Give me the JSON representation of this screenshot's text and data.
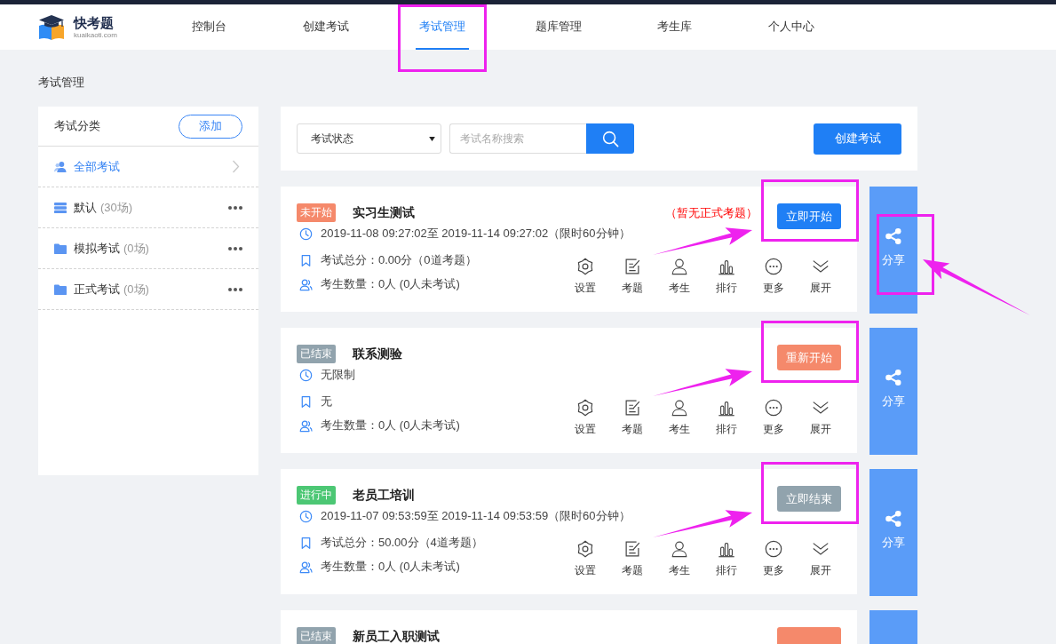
{
  "header": {
    "logo": {
      "name": "快考题",
      "domain": "kuaikaoti.com"
    },
    "tabs": [
      {
        "label": "控制台",
        "selected": false,
        "highlighted": false
      },
      {
        "label": "创建考试",
        "selected": false,
        "highlighted": false
      },
      {
        "label": "考试管理",
        "selected": true,
        "highlighted": true
      },
      {
        "label": "题库管理",
        "selected": false,
        "highlighted": false
      },
      {
        "label": "考生库",
        "selected": false,
        "highlighted": false
      },
      {
        "label": "个人中心",
        "selected": false,
        "highlighted": false
      }
    ]
  },
  "page_title": "考试管理",
  "categories": {
    "title": "考试分类",
    "add_button": "添加",
    "items": [
      {
        "label": "全部考试",
        "kind": "all",
        "selected": true
      },
      {
        "label": "默认",
        "count": "(30场)",
        "kind": "default",
        "selected": false
      },
      {
        "label": "模拟考试",
        "count": "(0场)",
        "kind": "folder",
        "selected": false
      },
      {
        "label": "正式考试",
        "count": "(0场)",
        "kind": "folder",
        "selected": false
      }
    ]
  },
  "toolbar": {
    "status_filter": {
      "value": "考试状态"
    },
    "search": {
      "placeholder": "考试名称搜索"
    },
    "create_button": "创建考试"
  },
  "exams": [
    {
      "status": {
        "label": "未开始",
        "kind": "not_started"
      },
      "title": "实习生测试",
      "note": "（暂无正式考题）",
      "details": [
        {
          "kind": "time",
          "text": "2019-11-08 09:27:02至 2019-11-14 09:27:02（限时60分钟）"
        },
        {
          "kind": "score",
          "text": "考试总分：0.00分（0道考题）"
        },
        {
          "kind": "examinees",
          "text": "考生数量：0人 (0人未考试)"
        }
      ],
      "action": {
        "label": "立即开始",
        "kind": "start",
        "highlighted": true,
        "pointed_at": true
      },
      "tools": [
        {
          "kind": "settings",
          "label": "设置"
        },
        {
          "kind": "questions",
          "label": "考题"
        },
        {
          "kind": "examinees",
          "label": "考生"
        },
        {
          "kind": "ranking",
          "label": "排行"
        },
        {
          "kind": "more",
          "label": "更多"
        },
        {
          "kind": "expand",
          "label": "展开"
        }
      ],
      "share": {
        "label": "分享",
        "highlighted": true,
        "pointed_at": true
      }
    },
    {
      "status": {
        "label": "已结束",
        "kind": "ended"
      },
      "title": "联系测验",
      "details": [
        {
          "kind": "time",
          "text": "无限制"
        },
        {
          "kind": "score",
          "text": "无"
        },
        {
          "kind": "examinees",
          "text": "考生数量：0人 (0人未考试)"
        }
      ],
      "action": {
        "label": "重新开始",
        "kind": "restart",
        "highlighted": true,
        "pointed_at": true
      },
      "tools": [
        {
          "kind": "settings",
          "label": "设置"
        },
        {
          "kind": "questions",
          "label": "考题"
        },
        {
          "kind": "examinees",
          "label": "考生"
        },
        {
          "kind": "ranking",
          "label": "排行"
        },
        {
          "kind": "more",
          "label": "更多"
        },
        {
          "kind": "expand",
          "label": "展开"
        }
      ],
      "share": {
        "label": "分享",
        "highlighted": false,
        "pointed_at": false
      }
    },
    {
      "status": {
        "label": "进行中",
        "kind": "ongoing"
      },
      "title": "老员工培训",
      "details": [
        {
          "kind": "time",
          "text": "2019-11-07 09:53:59至 2019-11-14 09:53:59（限时60分钟）"
        },
        {
          "kind": "score",
          "text": "考试总分：50.00分（4道考题）"
        },
        {
          "kind": "examinees",
          "text": "考生数量：0人 (0人未考试)"
        }
      ],
      "action": {
        "label": "立即结束",
        "kind": "end",
        "highlighted": true,
        "pointed_at": true
      },
      "tools": [
        {
          "kind": "settings",
          "label": "设置"
        },
        {
          "kind": "questions",
          "label": "考题"
        },
        {
          "kind": "examinees",
          "label": "考生"
        },
        {
          "kind": "ranking",
          "label": "排行"
        },
        {
          "kind": "more",
          "label": "更多"
        },
        {
          "kind": "expand",
          "label": "展开"
        }
      ],
      "share": {
        "label": "分享",
        "highlighted": false,
        "pointed_at": false
      }
    },
    {
      "status": {
        "label": "已结束",
        "kind": "ended"
      },
      "title": "新员工入职测试",
      "action": {
        "kind": "restart",
        "highlighted": false,
        "pointed_at": false
      },
      "share": {
        "highlighted": false,
        "pointed_at": false
      }
    }
  ]
}
